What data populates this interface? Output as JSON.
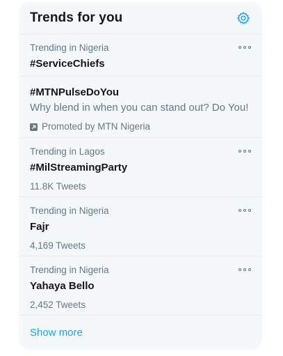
{
  "header": {
    "title": "Trends for you",
    "settings_icon": "gear-icon",
    "accent": "#1da1f2"
  },
  "trends": [
    {
      "context": "Trending in Nigeria",
      "name": "#ServiceChiefs"
    },
    {
      "name": "#MTNPulseDoYou",
      "description": "Why blend in when you can stand out? Do You!",
      "promoted": "Promoted by MTN Nigeria"
    },
    {
      "context": "Trending in Lagos",
      "name": "#MilStreamingParty",
      "count": "11.8K Tweets"
    },
    {
      "context": "Trending in Nigeria",
      "name": "Fajr",
      "count": "4,169 Tweets"
    },
    {
      "context": "Trending in Nigeria",
      "name": "Yahaya Bello",
      "count": "2,452 Tweets"
    }
  ],
  "footer": {
    "show_more": "Show more"
  }
}
